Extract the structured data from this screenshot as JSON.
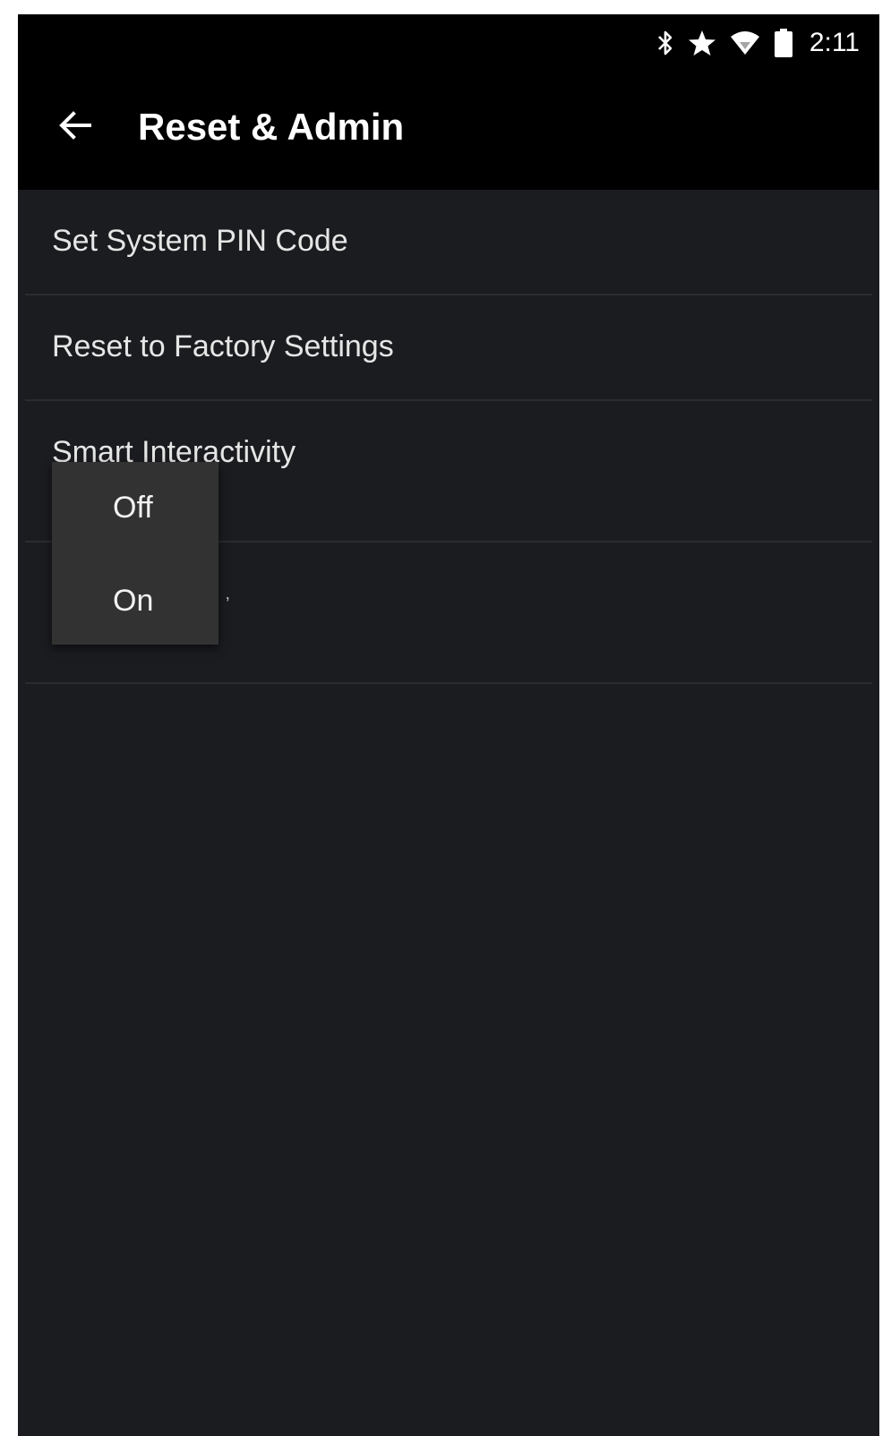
{
  "status_bar": {
    "time": "2:11",
    "icons": [
      "bluetooth-icon",
      "star-icon",
      "wifi-icon",
      "battery-icon"
    ]
  },
  "app_bar": {
    "title": "Reset & Admin",
    "back_icon": "arrow-left-icon"
  },
  "menu": {
    "items": [
      {
        "label": "Set System PIN Code"
      },
      {
        "label": "Reset to Factory Settings"
      },
      {
        "label": "Smart Interactivity"
      },
      {
        "label": ""
      }
    ]
  },
  "dropdown": {
    "options": [
      {
        "label": "Off"
      },
      {
        "label": "On"
      }
    ]
  },
  "colors": {
    "background": "#1b1c20",
    "bar": "#000000",
    "divider": "#2a2c31",
    "popup": "#323232",
    "text": "#ffffff"
  }
}
